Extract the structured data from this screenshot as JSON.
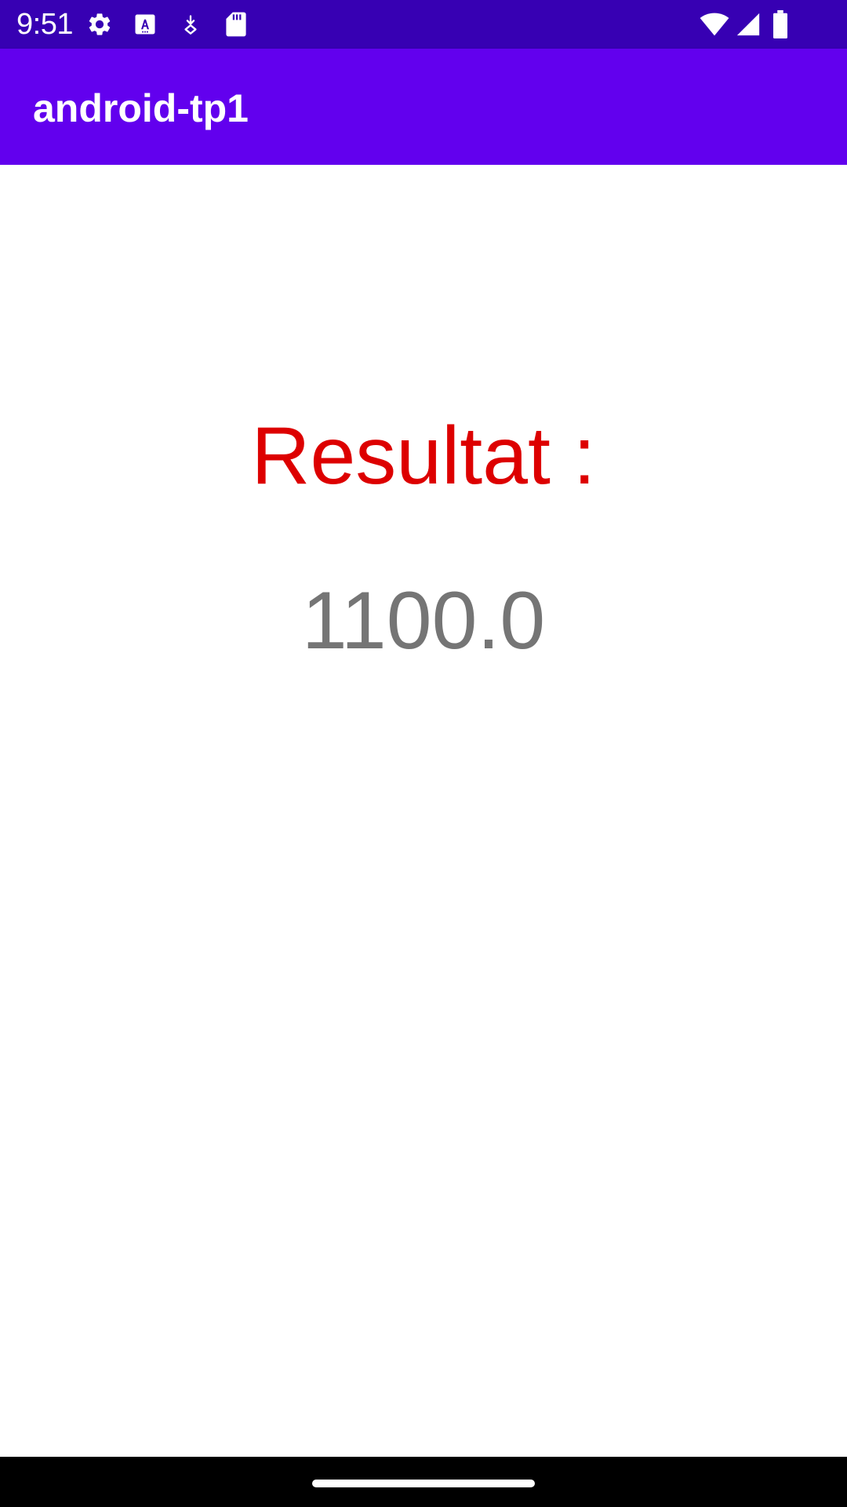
{
  "status_bar": {
    "time": "9:51",
    "background": "#3700b3",
    "left_icons": [
      "gear-icon",
      "text-a-icon",
      "download-icon",
      "sd-card-icon"
    ],
    "right_icons": [
      "wifi-icon",
      "cell-signal-icon",
      "battery-icon"
    ]
  },
  "app_bar": {
    "title": "android-tp1",
    "background": "#6200ee"
  },
  "content": {
    "result_label": "Resultat :",
    "result_label_color": "#dd0000",
    "result_value": "1100.0",
    "result_value_color": "#757575"
  },
  "nav_bar": {
    "background": "#000000",
    "handle": "home-handle"
  }
}
